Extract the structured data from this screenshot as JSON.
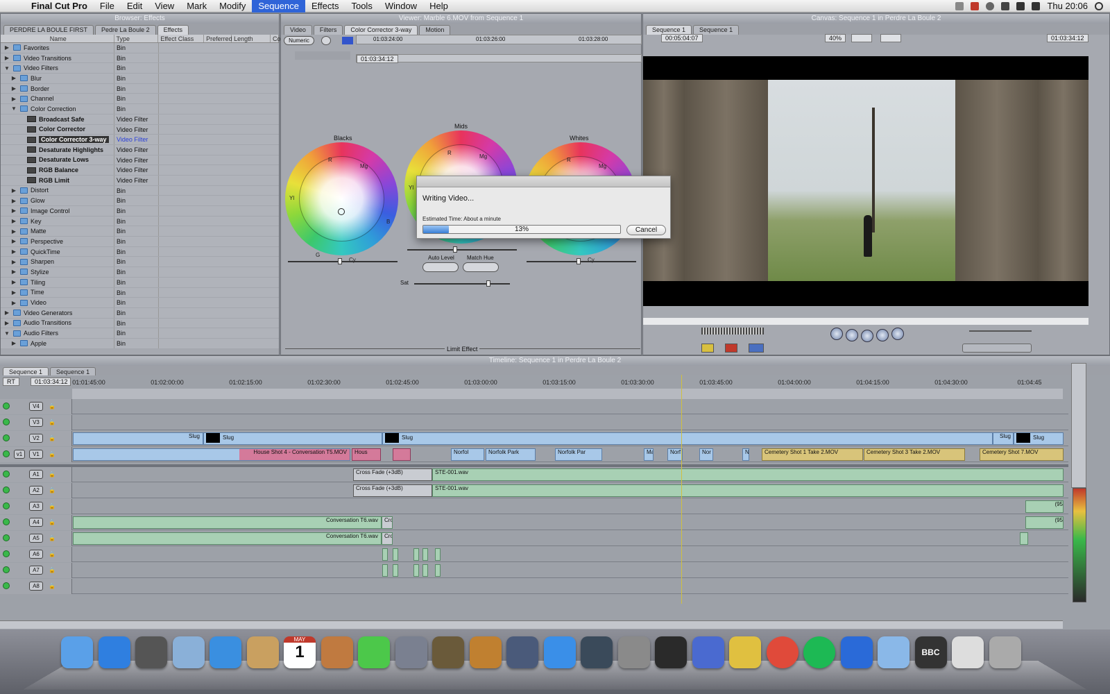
{
  "menubar": {
    "app": "Final Cut Pro",
    "items": [
      "File",
      "Edit",
      "View",
      "Mark",
      "Modify",
      "Sequence",
      "Effects",
      "Tools",
      "Window",
      "Help"
    ],
    "active": "Sequence",
    "clock": "Thu 20:06"
  },
  "browser": {
    "title": "Browser: Effects",
    "tabs": [
      "PERDRE LA BOULE FIRST",
      "Pedre La Boule 2",
      "Effects"
    ],
    "columns": [
      "Name",
      "Type",
      "Effect Class",
      "Preferred",
      "Length",
      "Co"
    ],
    "rows": [
      {
        "name": "Favorites",
        "type": "Bin"
      },
      {
        "name": "Video Transitions",
        "type": "Bin"
      },
      {
        "name": "Video Filters",
        "type": "Bin"
      },
      {
        "name": "Blur",
        "type": "Bin"
      },
      {
        "name": "Border",
        "type": "Bin"
      },
      {
        "name": "Channel",
        "type": "Bin"
      },
      {
        "name": "Color Correction",
        "type": "Bin"
      },
      {
        "name": "Broadcast Safe",
        "type": "Video Filter"
      },
      {
        "name": "Color Corrector",
        "type": "Video Filter"
      },
      {
        "name": "Color Corrector 3-way",
        "type": "Video Filter"
      },
      {
        "name": "Desaturate Highlights",
        "type": "Video Filter"
      },
      {
        "name": "Desaturate Lows",
        "type": "Video Filter"
      },
      {
        "name": "RGB Balance",
        "type": "Video Filter"
      },
      {
        "name": "RGB Limit",
        "type": "Video Filter"
      },
      {
        "name": "Distort",
        "type": "Bin"
      },
      {
        "name": "Glow",
        "type": "Bin"
      },
      {
        "name": "Image Control",
        "type": "Bin"
      },
      {
        "name": "Key",
        "type": "Bin"
      },
      {
        "name": "Matte",
        "type": "Bin"
      },
      {
        "name": "Perspective",
        "type": "Bin"
      },
      {
        "name": "QuickTime",
        "type": "Bin"
      },
      {
        "name": "Sharpen",
        "type": "Bin"
      },
      {
        "name": "Stylize",
        "type": "Bin"
      },
      {
        "name": "Tiling",
        "type": "Bin"
      },
      {
        "name": "Time",
        "type": "Bin"
      },
      {
        "name": "Video",
        "type": "Bin"
      },
      {
        "name": "Video Generators",
        "type": "Bin"
      },
      {
        "name": "Audio Transitions",
        "type": "Bin"
      },
      {
        "name": "Audio Filters",
        "type": "Bin"
      },
      {
        "name": "Apple",
        "type": "Bin"
      }
    ]
  },
  "viewer": {
    "title": "Viewer: Marble 6.MOV from Sequence 1",
    "tabs": [
      "Video",
      "Filters",
      "Color Corrector 3-way",
      "Motion"
    ],
    "numeric_label": "Numeric",
    "ruler": [
      "01:03:24:00",
      "01:03:26:00",
      "01:03:28:00"
    ],
    "timecode": "01:03:34:12",
    "wheels": {
      "blacks": "Blacks",
      "mids": "Mids",
      "whites": "Whites"
    },
    "wheel_letters": {
      "r": "R",
      "mg": "Mg",
      "b": "B",
      "cy": "Cy",
      "g": "G",
      "yl": "Yl"
    },
    "auto_level": "Auto Level",
    "match_hue": "Match Hue",
    "sat": "Sat",
    "limit_effect": "Limit Effect"
  },
  "dialog": {
    "title": "Writing Video...",
    "estimate": "Estimated Time: About a minute",
    "progress": 0.13,
    "progress_label": "13%",
    "cancel": "Cancel"
  },
  "canvas": {
    "title": "Canvas: Sequence 1 in Perdre La Boule 2",
    "tabs": [
      "Sequence 1",
      "Sequence 1"
    ],
    "duration": "00:05:04:07",
    "zoom": "40%",
    "timecode": "01:03:34:12"
  },
  "timeline": {
    "title": "Timeline: Sequence 1 in Perdre La Boule 2",
    "tabs": [
      "Sequence 1",
      "Sequence 1"
    ],
    "rt": "RT",
    "timecode": "01:03:34:12",
    "ruler": [
      "01:01:45:00",
      "01:02:00:00",
      "01:02:15:00",
      "01:02:30:00",
      "01:02:45:00",
      "01:03:00:00",
      "01:03:15:00",
      "01:03:30:00",
      "01:03:45:00",
      "01:04:00:00",
      "01:04:15:00",
      "01:04:30:00",
      "01:04:45"
    ],
    "video_tracks": [
      "V4",
      "V3",
      "V2",
      "V1"
    ],
    "audio_tracks": [
      "A1",
      "A2",
      "A3",
      "A4",
      "A5",
      "A6",
      "A7",
      "A8"
    ],
    "v1_label": "v1",
    "clips": {
      "slug": "Slug",
      "house": "House Shot 4 - Conversation T5.MOV",
      "hous_short": "Hous",
      "norfolk_a": "Norfol",
      "norfolk_b": "Norfolk Park",
      "norfolk_c": "Norfolk Par",
      "ma": "Ma",
      "norf": "Norf",
      "nor": "Nor",
      "n": "N",
      "cem1": "Cemetery Shot 1 Take 2.MOV",
      "cem3": "Cemetery Shot 3 Take 2.MOV",
      "cem7": "Cemetery Shot 7.MOV",
      "crossfade": "Cross Fade (+3dB)",
      "ste": "STE-001.wav",
      "conv": "Conversation T6.wav",
      "cro": "Cro",
      "a3_tail": "(95",
      "a4_tail": "(95"
    }
  },
  "dock": {
    "apps": [
      "finder-icon",
      "app-store-icon",
      "dashboard-icon",
      "mail-icon",
      "safari-icon",
      "address-book-icon",
      "ical-icon",
      "iphoto-icon",
      "sims-icon",
      "image-capture-icon",
      "imovie-icon",
      "garageband-icon",
      "mission-control-icon",
      "itunes-icon",
      "time-machine-icon",
      "system-preferences-icon",
      "final-cut-icon",
      "dvd-player-icon",
      "burn-icon",
      "chrome-icon",
      "spotify-icon",
      "quicktime-icon",
      "folder-icon",
      "bbc-icon",
      "documents-icon",
      "trash-icon"
    ],
    "ical_month": "MAY",
    "ical_day": "1",
    "bbc_label": "BBC"
  }
}
